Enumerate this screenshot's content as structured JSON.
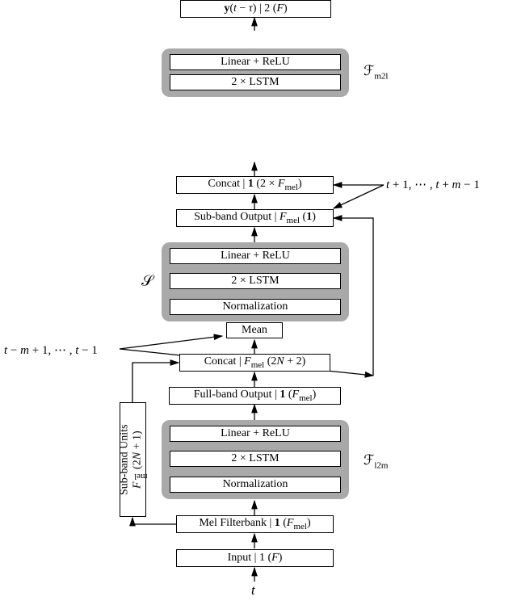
{
  "labels": {
    "t_bottom": "t",
    "input": "Input | 1 (F)",
    "mel_filterbank": "Mel Filterbank | 1 (Fₘₑₗ)",
    "subband_units_line1": "Sub-band Units",
    "subband_units_line2": "Fₘₑₗ (2N + 1)",
    "f_l2m_norm": "Normalization",
    "f_l2m_lstm": "2 × LSTM",
    "f_l2m_linear": "Linear + ReLU",
    "fullband_output": "Full-band Output | 1 (Fₘₑₗ)",
    "concat_lower": "Concat | Fₘₑₗ (2N + 2)",
    "mean": "Mean",
    "left_time": "t − m + 1, ⋯ , t − 1",
    "s_norm": "Normalization",
    "s_lstm": "2 × LSTM",
    "s_linear": "Linear + ReLU",
    "subband_output": "Sub-band Output | Fₘₑₗ (1)",
    "concat_upper": "Concat | 1 (2 × Fₘₑₗ)",
    "right_time": "t + 1, ⋯ , t + m − 1",
    "f_m2l_lstm": "2 × LSTM",
    "f_m2l_linear": "Linear + ReLU",
    "output_y": "y(t − τ) | 2 (F)",
    "F_l2m": "ℱₗ₂ₘ",
    "S": "𝒮",
    "F_m2l": "ℱₘ₂ₗ"
  }
}
